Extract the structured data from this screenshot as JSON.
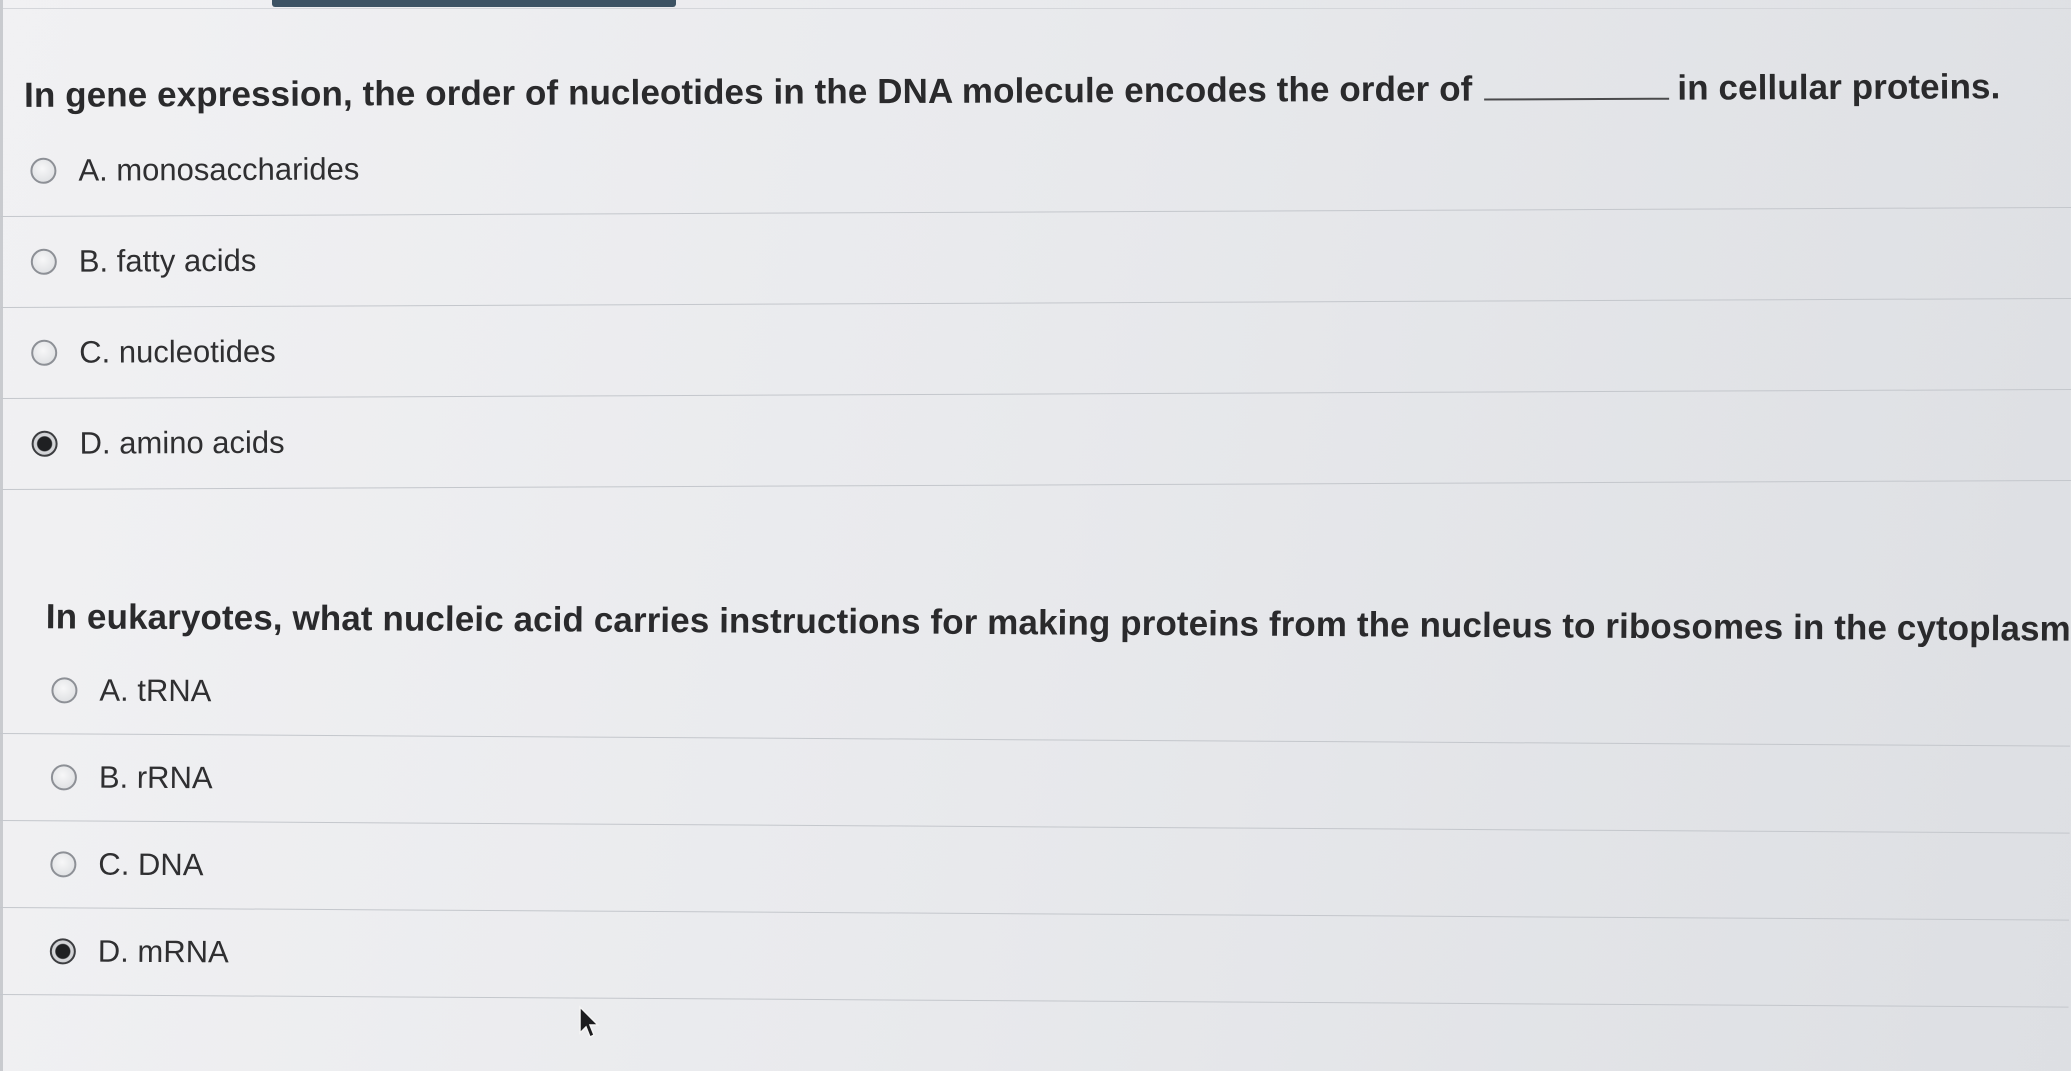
{
  "questions": [
    {
      "prompt_before": "In gene expression, the order of nucleotides in the DNA molecule encodes the order of",
      "prompt_after": "in cellular proteins.",
      "options": [
        {
          "label": "A. monosaccharides",
          "selected": false
        },
        {
          "label": "B. fatty acids",
          "selected": false
        },
        {
          "label": "C. nucleotides",
          "selected": false
        },
        {
          "label": "D. amino acids",
          "selected": true
        }
      ]
    },
    {
      "prompt": "In eukaryotes, what nucleic acid carries instructions for making proteins from the nucleus to ribosomes in the cytoplasm?",
      "options": [
        {
          "label": "A. tRNA",
          "selected": false
        },
        {
          "label": "B. rRNA",
          "selected": false
        },
        {
          "label": "C. DNA",
          "selected": false
        },
        {
          "label": "D. mRNA",
          "selected": true
        }
      ]
    }
  ],
  "colors": {
    "top_tab": "#3d5364",
    "text": "#2a2a2c",
    "divider": "#c4c7cc"
  },
  "icons": {
    "cursor": "mouse-pointer-icon"
  }
}
